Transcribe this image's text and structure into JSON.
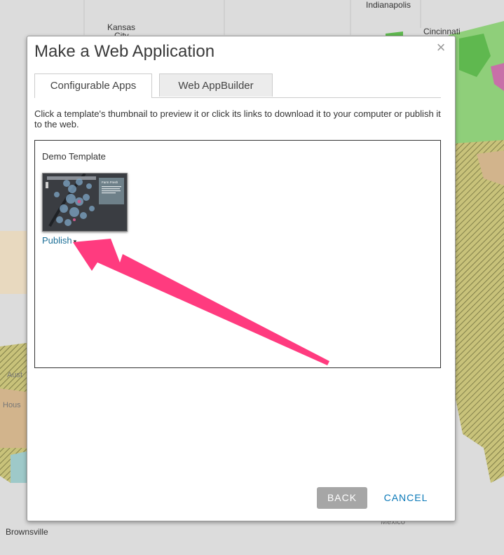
{
  "map": {
    "cities": {
      "kansas": "Kansas",
      "kansas_city_fragment": "City",
      "indianapolis": "Indianapolis",
      "cincinnati": "Cincinnati",
      "brownsville": "Brownsville",
      "mexico": "Mexico",
      "austin_fragment": "Aust",
      "houston_fragment": "Hous"
    }
  },
  "dialog": {
    "title": "Make a Web Application",
    "close_glyph": "×",
    "tabs": [
      {
        "label": "Configurable Apps",
        "active": true
      },
      {
        "label": "Web AppBuilder",
        "active": false
      }
    ],
    "instructions": "Click a template's thumbnail to preview it or click its links to download it to your computer or publish it to the web.",
    "template": {
      "name": "Demo Template",
      "thumbnail_title": "Farm Fresh",
      "publish_label": "Publish",
      "publish_caret": "▾"
    },
    "buttons": {
      "back": "BACK",
      "cancel": "CANCEL"
    }
  },
  "annotation": {
    "arrow_color": "#ff3b7f"
  },
  "colors": {
    "link": "#1c6f97",
    "cancel": "#0b79b8",
    "back_bg": "#a6a6a6"
  }
}
